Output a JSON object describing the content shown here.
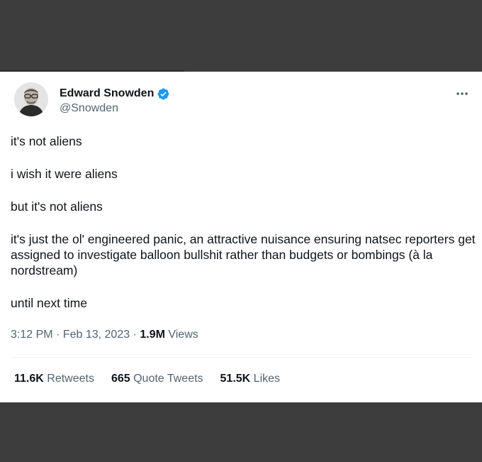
{
  "tweet": {
    "author": {
      "name": "Edward Snowden",
      "handle": "@Snowden",
      "verified": true,
      "badge_color": "#1d9bf0"
    },
    "more_icon": "more-horizontal-icon",
    "paragraphs": [
      "it's not aliens",
      "i wish it were aliens",
      "but it's not aliens",
      "it's just the ol' engineered panic, an attractive nuisance ensuring natsec reporters get assigned to investigate balloon bullshit rather than budgets or bombings (à la nordstream)",
      "until next time"
    ],
    "timestamp": "3:12 PM · Feb 13, 2023 · ",
    "views_count": "1.9M",
    "views_label": " Views",
    "stats": {
      "retweets_count": "11.6K",
      "retweets_label": " Retweets",
      "quotes_count": "665",
      "quotes_label": " Quote Tweets",
      "likes_count": "51.5K",
      "likes_label": " Likes"
    }
  },
  "colors": {
    "background": "#3d3d3d",
    "card": "#ffffff",
    "text_primary": "#0f1419",
    "text_secondary": "#536471"
  }
}
